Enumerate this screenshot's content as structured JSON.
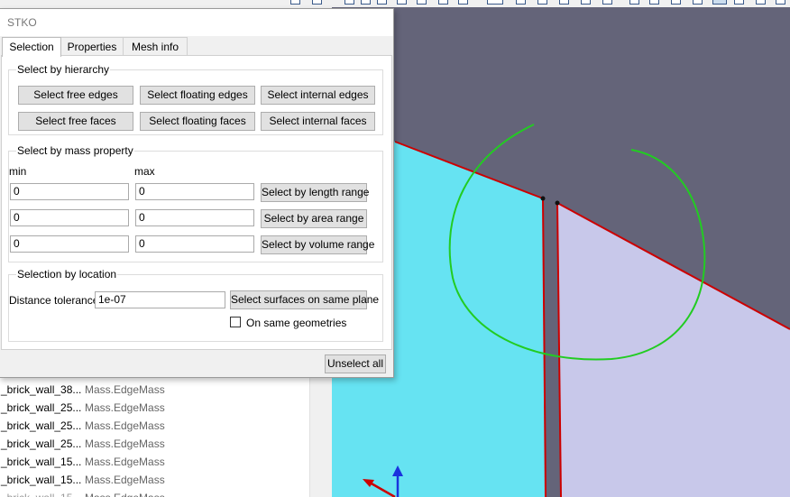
{
  "dialog": {
    "title": "STKO",
    "tabs": [
      {
        "label": "Selection",
        "active": true
      },
      {
        "label": "Properties",
        "active": false
      },
      {
        "label": "Mesh info",
        "active": false
      }
    ],
    "hierarchy": {
      "title": "Select by hierarchy",
      "buttons": [
        "Select free edges",
        "Select floating edges",
        "Select internal edges",
        "Select free faces",
        "Select floating faces",
        "Select internal faces"
      ]
    },
    "mass_property": {
      "title": "Select by mass property",
      "min_label": "min",
      "max_label": "max",
      "rows": [
        {
          "min": "0",
          "max": "0",
          "button": "Select by length range"
        },
        {
          "min": "0",
          "max": "0",
          "button": "Select by area range"
        },
        {
          "min": "0",
          "max": "0",
          "button": "Select by volume range"
        }
      ]
    },
    "location": {
      "title": "Selection by location",
      "distance_label": "Distance tolerance",
      "distance_value": "1e-07",
      "same_plane_button": "Select surfaces on same plane",
      "same_geometries_label": "On same geometries",
      "same_geometries_checked": false
    },
    "unselect_button": "Unselect all"
  },
  "left_list": {
    "rows": [
      {
        "name": "_brick_wall_38...",
        "type": "Mass.EdgeMass"
      },
      {
        "name": "_brick_wall_25...",
        "type": "Mass.EdgeMass"
      },
      {
        "name": "_brick_wall_25...",
        "type": "Mass.EdgeMass"
      },
      {
        "name": "_brick_wall_25...",
        "type": "Mass.EdgeMass"
      },
      {
        "name": "_brick_wall_15...",
        "type": "Mass.EdgeMass"
      },
      {
        "name": "_brick_wall_15...",
        "type": "Mass.EdgeMass"
      }
    ]
  },
  "viewport": {
    "colors": {
      "background": "#646479",
      "left_face": "#66e3f2",
      "right_face": "#c8c8ea",
      "edge": "#cc0000",
      "annotation": "#22cc22",
      "axis_z": "#1a33dd",
      "axis_x": "#cc0000"
    }
  }
}
